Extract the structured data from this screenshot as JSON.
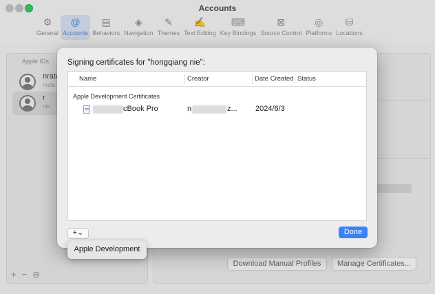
{
  "window": {
    "title": "Accounts"
  },
  "toolbar": {
    "items": [
      {
        "label": "General",
        "icon": "⚙"
      },
      {
        "label": "Accounts",
        "icon": "@"
      },
      {
        "label": "Behaviors",
        "icon": "▤"
      },
      {
        "label": "Navigation",
        "icon": "◈"
      },
      {
        "label": "Themes",
        "icon": "✎"
      },
      {
        "label": "Text Editing",
        "icon": "✍"
      },
      {
        "label": "Key Bindings",
        "icon": "⌨"
      },
      {
        "label": "Source Control",
        "icon": "⊠"
      },
      {
        "label": "Platforms",
        "icon": "◎"
      },
      {
        "label": "Locations",
        "icon": "⛁"
      }
    ]
  },
  "sidebar": {
    "header": "Apple IDs",
    "accounts": [
      {
        "name": "nrate",
        "sub": "nrate"
      },
      {
        "name": "r",
        "sub": "nie"
      }
    ]
  },
  "main": {
    "download_profiles_label": "Download Manual Profiles",
    "manage_certificates_label": "Manage Certificates..."
  },
  "sheet": {
    "title": "Signing certificates for \"hongqiang nie\":",
    "columns": {
      "name": "Name",
      "creator": "Creator",
      "date": "Date Created",
      "status": "Status"
    },
    "group_label": "Apple Development Certificates",
    "rows": [
      {
        "name_visible": "cBook Pro",
        "creator_prefix": "n",
        "creator_suffix": "z...",
        "date": "2024/6/3",
        "status": ""
      }
    ],
    "add_button_label": "+⌄",
    "done_label": "Done"
  },
  "menu": {
    "items": [
      "Apple Development"
    ]
  },
  "colors": {
    "accent": "#3b82f6",
    "active_tab": "#cfd9e9",
    "traffic_green": "#35c759"
  }
}
